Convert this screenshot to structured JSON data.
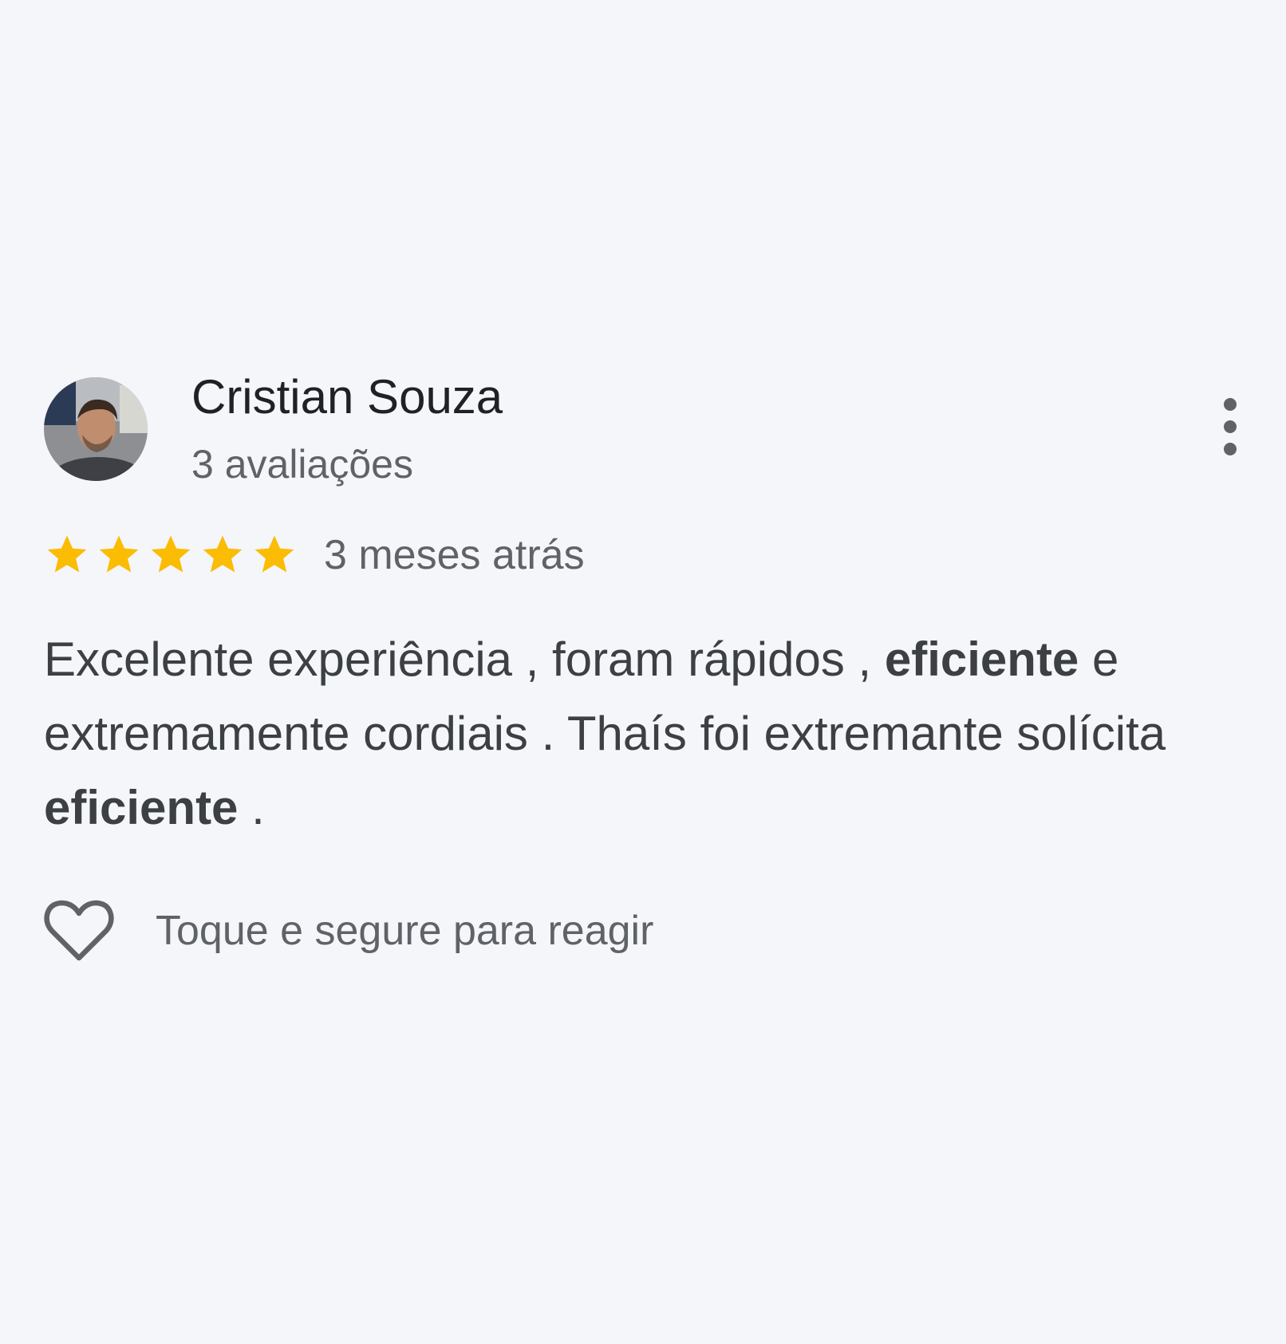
{
  "review": {
    "reviewer_name": "Cristian Souza",
    "review_count": "3 avaliações",
    "rating": 5,
    "rating_max": 5,
    "date": "3 meses atrás",
    "text": {
      "line1_a": "Excelente experiência , foram rápidos , ",
      "line1_bold": "eficiente",
      "line1_b": " e",
      "line2": "extremamente cordiais . Thaís foi extremante solícita",
      "line3_bold": "eficiente",
      "line3_b": " ."
    },
    "react_label": "Toque e segure para reagir"
  },
  "icons": {
    "avatar": "avatar-photo",
    "more": "more-vertical-icon",
    "star": "star-icon",
    "react": "heart-outline-icon"
  },
  "colors": {
    "background": "#f5f6fa",
    "star": "#fbbc04",
    "name": "#202124",
    "secondary_text": "#5f6368",
    "body_text": "#3c4043"
  }
}
